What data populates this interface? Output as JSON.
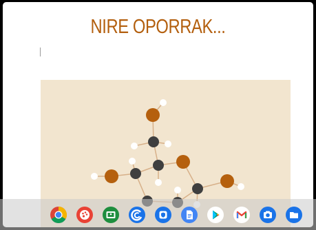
{
  "slide": {
    "title": "NIRE OPORRAK..."
  },
  "image": {
    "subject": "molecule",
    "colors": {
      "background": "#f2e5cf",
      "oxygen": "#b5600e",
      "carbon": "#3f3f3f",
      "hydrogen": "#ffffff",
      "bond": "#d7b089"
    }
  },
  "shelf": {
    "apps": [
      {
        "icon": "chrome-icon",
        "color": "#ffffff"
      },
      {
        "icon": "palette-icon",
        "color": "#e94235"
      },
      {
        "icon": "classroom-icon",
        "color": "#1e8e3e"
      },
      {
        "icon": "google-arc-icon",
        "color": "#1a73e8"
      },
      {
        "icon": "shield-app-icon",
        "color": "#1a73e8"
      },
      {
        "icon": "docs-icon",
        "color": "#4285f4"
      },
      {
        "icon": "play-store-icon",
        "color": "#ffffff"
      },
      {
        "icon": "gmail-icon",
        "color": "#ffffff"
      },
      {
        "icon": "camera-icon",
        "color": "#1a73e8"
      },
      {
        "icon": "files-icon",
        "color": "#1a73e8"
      }
    ]
  }
}
